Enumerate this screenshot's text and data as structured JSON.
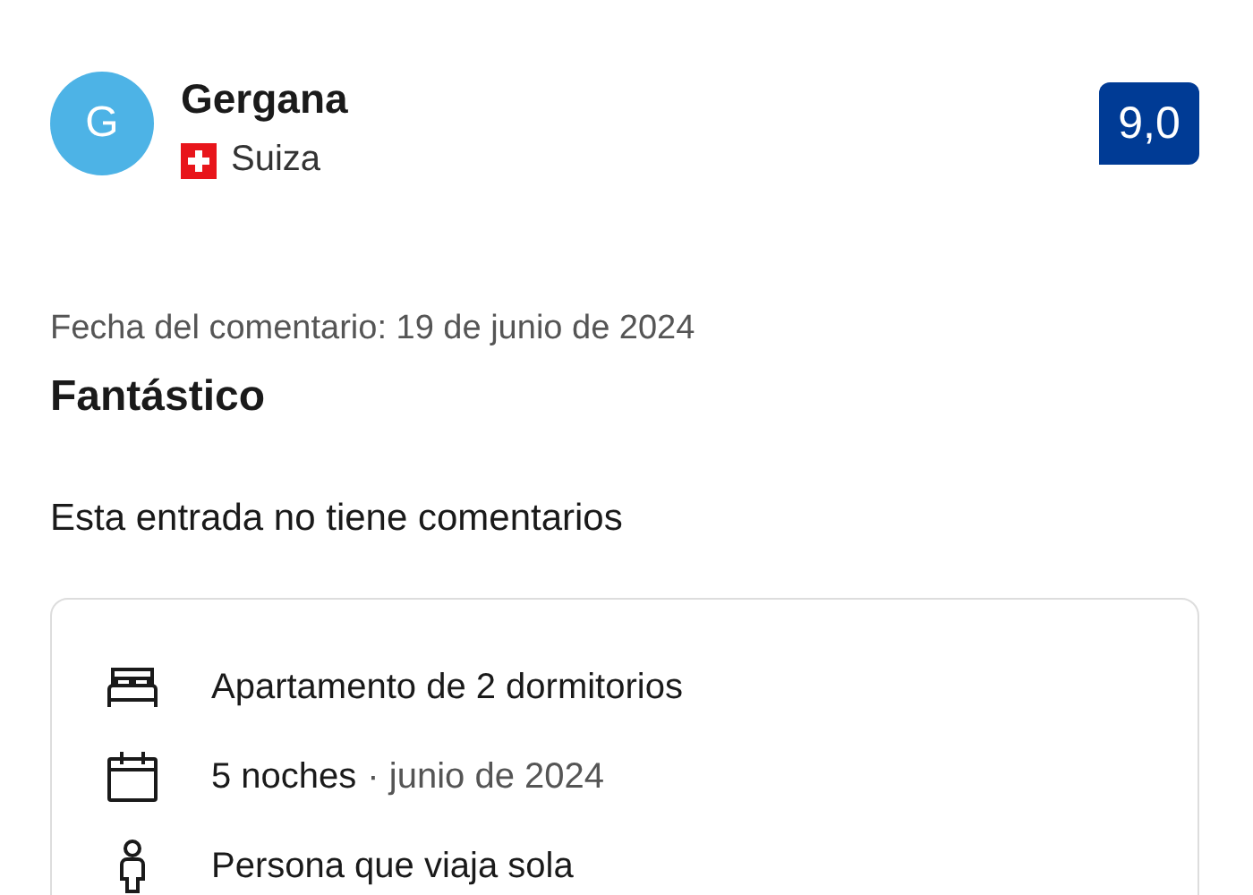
{
  "reviewer": {
    "initial": "G",
    "name": "Gergana",
    "country": "Suiza"
  },
  "score": "9,0",
  "review_date": "Fecha del comentario: 19 de junio de 2024",
  "review_title": "Fantástico",
  "review_text": "Esta entrada no tiene comentarios",
  "stay_details": [
    {
      "kind": "bed",
      "text": "Apartamento de 2 dormitorios"
    },
    {
      "kind": "calendar",
      "text": "5 noches",
      "detail": "· junio de 2024"
    },
    {
      "kind": "person",
      "text": "Persona que viaja sola"
    }
  ]
}
